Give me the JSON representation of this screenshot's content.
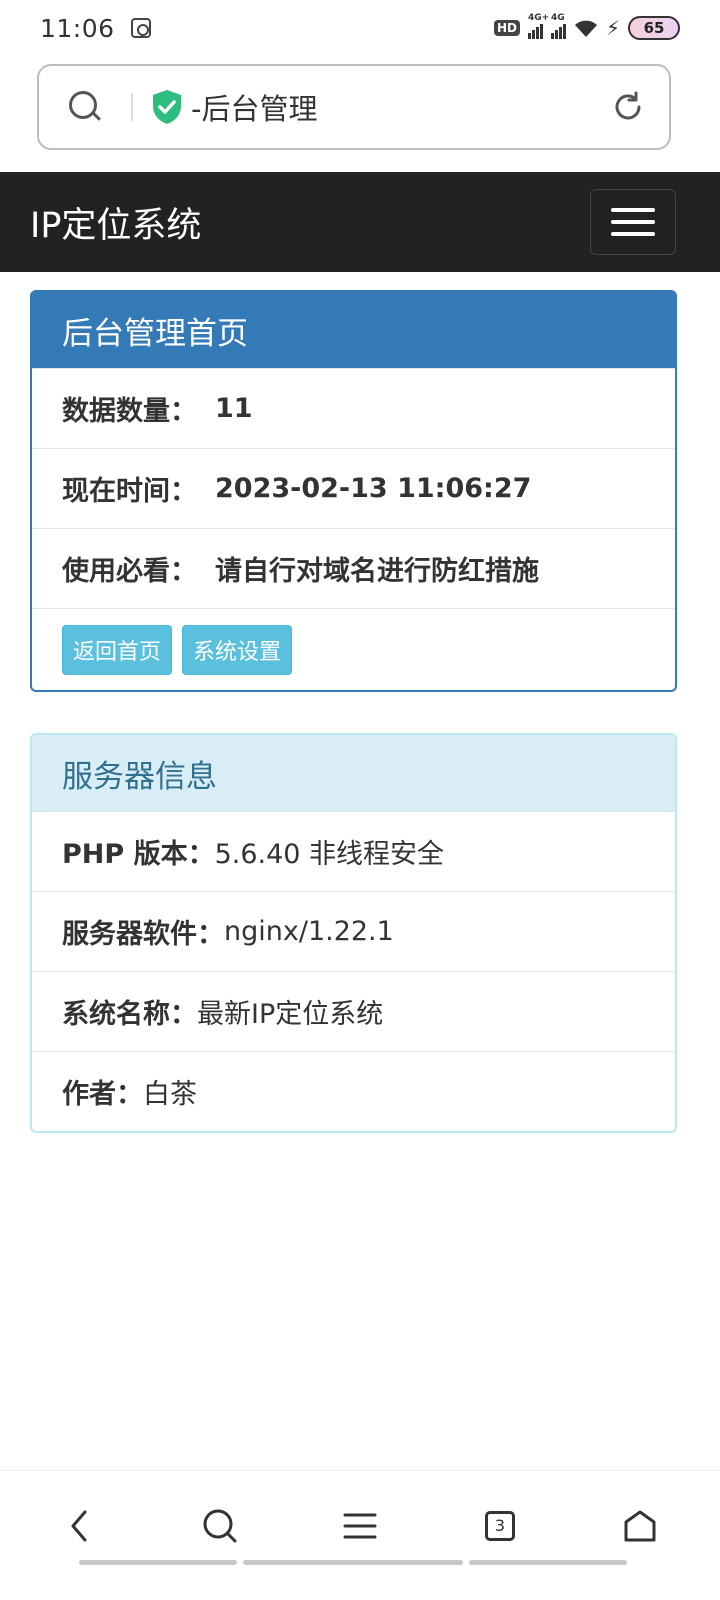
{
  "status_bar": {
    "time": "11:06",
    "hd_label": "HD",
    "net1": "4G+",
    "net2": "4G",
    "battery": "65"
  },
  "address_bar": {
    "title": "-后台管理"
  },
  "navbar": {
    "brand": "IP定位系统"
  },
  "admin_panel": {
    "heading": "后台管理首页",
    "rows": [
      {
        "label": "数据数量：",
        "value": "11"
      },
      {
        "label": "现在时间：",
        "value": "2023-02-13 11:06:27"
      },
      {
        "label": "使用必看：",
        "value": "请自行对域名进行防红措施"
      }
    ],
    "buttons": {
      "home": "返回首页",
      "settings": "系统设置"
    }
  },
  "server_panel": {
    "heading": "服务器信息",
    "rows": [
      {
        "label": "PHP 版本：",
        "value": "5.6.40 非线程安全"
      },
      {
        "label": "服务器软件：",
        "value": "nginx/1.22.1"
      },
      {
        "label": "系统名称：",
        "value": "最新IP定位系统"
      },
      {
        "label": "作者：",
        "value": "白茶"
      }
    ]
  },
  "bottom_nav": {
    "tab_count": "3"
  },
  "colors": {
    "navbar_bg": "#222222",
    "primary": "#337ab7",
    "info_heading_bg": "#d9edf7",
    "info_heading_text": "#31708f",
    "button_info": "#5bc0de",
    "secure_shield": "#2dbd7e"
  },
  "icons": [
    "search-icon",
    "shield-check-icon",
    "reload-icon",
    "hamburger-icon",
    "back-icon",
    "search-icon",
    "menu-icon",
    "tabs-icon",
    "home-icon"
  ]
}
